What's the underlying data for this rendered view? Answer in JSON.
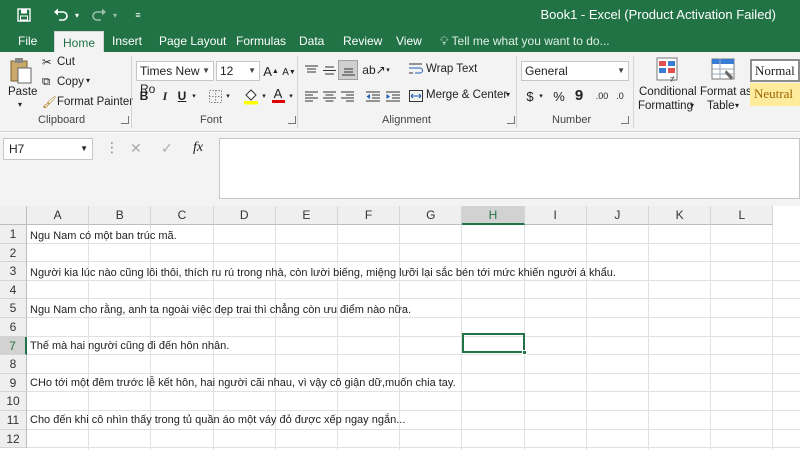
{
  "titlebar": {
    "title": "Book1 - Excel (Product Activation Failed)",
    "save_icon": "save-icon",
    "undo_icon": "undo-icon",
    "redo_icon": "redo-icon",
    "customize_icon": "customize-qat-icon"
  },
  "tabs": {
    "file": "File",
    "home": "Home",
    "insert": "Insert",
    "page_layout": "Page Layout",
    "formulas": "Formulas",
    "data": "Data",
    "review": "Review",
    "view": "View",
    "tell_me": "Tell me what you want to do..."
  },
  "clipboard": {
    "paste": "Paste",
    "cut": "Cut",
    "copy": "Copy",
    "format_painter": "Format Painter",
    "label": "Clipboard"
  },
  "font": {
    "name": "Times New Ro",
    "size": "12",
    "label": "Font",
    "bold": "B",
    "italic": "I",
    "underline": "U",
    "color_letter": "A"
  },
  "alignment": {
    "wrap_text": "Wrap Text",
    "merge_center": "Merge & Center",
    "label": "Alignment"
  },
  "number": {
    "format": "General",
    "currency": "$",
    "percent": "%",
    "comma": "9",
    "inc_decimal": ".00",
    "dec_decimal": ".0",
    "label": "Number"
  },
  "styles": {
    "conditional_formatting_1": "Conditional",
    "conditional_formatting_2": "Formatting",
    "format_as_table_1": "Format as",
    "format_as_table_2": "Table",
    "normal": "Normal",
    "neutral": "Neutral"
  },
  "formula_bar": {
    "name_box": "H7",
    "cancel": "✕",
    "enter": "✓",
    "fx": "fx",
    "value": ""
  },
  "grid": {
    "columns": [
      "A",
      "B",
      "C",
      "D",
      "E",
      "F",
      "G",
      "H",
      "I",
      "J",
      "K",
      "L"
    ],
    "rows": [
      "1",
      "2",
      "3",
      "4",
      "5",
      "6",
      "7",
      "8",
      "9",
      "10",
      "11",
      "12"
    ],
    "selected_column": "H",
    "selected_row": "7",
    "cells": {
      "A1": "Ngu Nam có một ban trúc mã.",
      "A3": "Người kia lúc nào cũng lôi thôi, thích ru rú trong nhà, còn lười biếng, miệng lưỡi lại sắc bén tới mức khiến người á khẩu.",
      "A5": "Ngu Nam cho rằng, anh ta ngoài việc đẹp trai thì chẳng còn ưu điểm nào nữa.",
      "A7": "Thế mà hai người cũng đi đến hôn nhân.",
      "A9": "CHo tới một đêm trước lễ kết hôn, hai người cãi nhau, vì vậy cô giận dữ,muốn chia tay.",
      "A11": "Cho đến khi cô nhìn thấy trong tủ quần áo một váy đỏ được xếp ngay ngắn..."
    }
  }
}
